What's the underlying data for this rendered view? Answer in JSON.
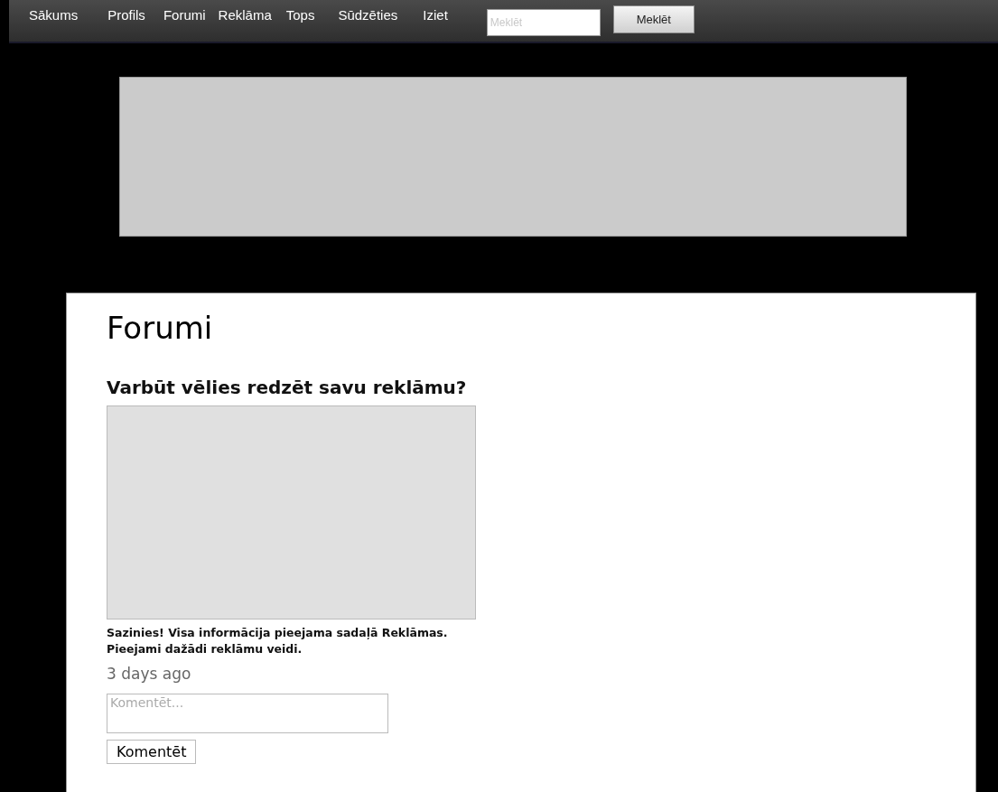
{
  "nav": {
    "items": [
      {
        "label": "Sākums"
      },
      {
        "label": "Profils"
      },
      {
        "label": "Forumi"
      },
      {
        "label": "Reklāma"
      },
      {
        "label": "Tops"
      },
      {
        "label": "Sūdzēties"
      },
      {
        "label": "Iziet"
      }
    ],
    "search": {
      "placeholder": "Meklēt"
    },
    "search_button": "Meklēt"
  },
  "page": {
    "title": "Forumi",
    "post": {
      "heading": "Varbūt vēlies redzēt savu reklāmu?",
      "text": "Sazinies! Visa informācija pieejama sadaļā Reklāmas. Pieejami dažādi reklāmu veidi.",
      "time": "3 days ago",
      "comment": {
        "placeholder": "Komentēt...",
        "button": "Komentēt"
      }
    }
  }
}
